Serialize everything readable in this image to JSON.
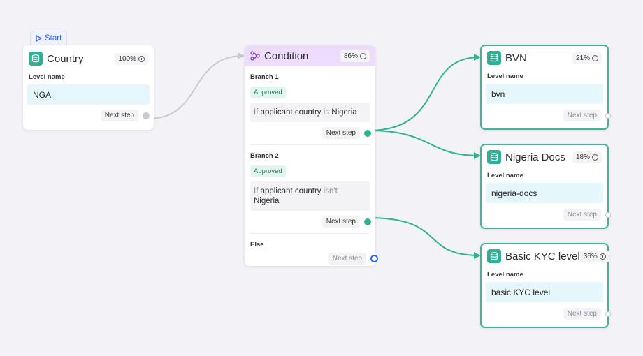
{
  "start_label": "Start",
  "country": {
    "title": "Country",
    "percent": "100%",
    "level_label": "Level name",
    "level_value": "NGA",
    "next_step": "Next step"
  },
  "condition": {
    "title": "Condition",
    "percent": "86%",
    "branch1": {
      "title": "Branch 1",
      "badge": "Approved",
      "kw_if": "If",
      "field": "applicant country",
      "op": "is",
      "value": "Nigeria",
      "next_step": "Next step"
    },
    "branch2": {
      "title": "Branch 2",
      "badge": "Approved",
      "kw_if": "If",
      "field": "applicant country",
      "op": "isn't",
      "value": "Nigeria",
      "next_step": "Next step"
    },
    "else": {
      "title": "Else",
      "next_step": "Next step"
    }
  },
  "levels": [
    {
      "title": "BVN",
      "percent": "21%",
      "level_label": "Level name",
      "level_value": "bvn",
      "next_step": "Next step"
    },
    {
      "title": "Nigeria Docs",
      "percent": "18%",
      "level_label": "Level name",
      "level_value": "nigeria-docs",
      "next_step": "Next step"
    },
    {
      "title": "Basic KYC level",
      "percent": "36%",
      "level_label": "Level name",
      "level_value": "basic KYC level",
      "next_step": "Next step"
    }
  ],
  "colors": {
    "teal": "#2fb393",
    "edge_grey": "#c9c9d3",
    "condition_header": "#eddcfb",
    "start_blue": "#2f64e8"
  }
}
